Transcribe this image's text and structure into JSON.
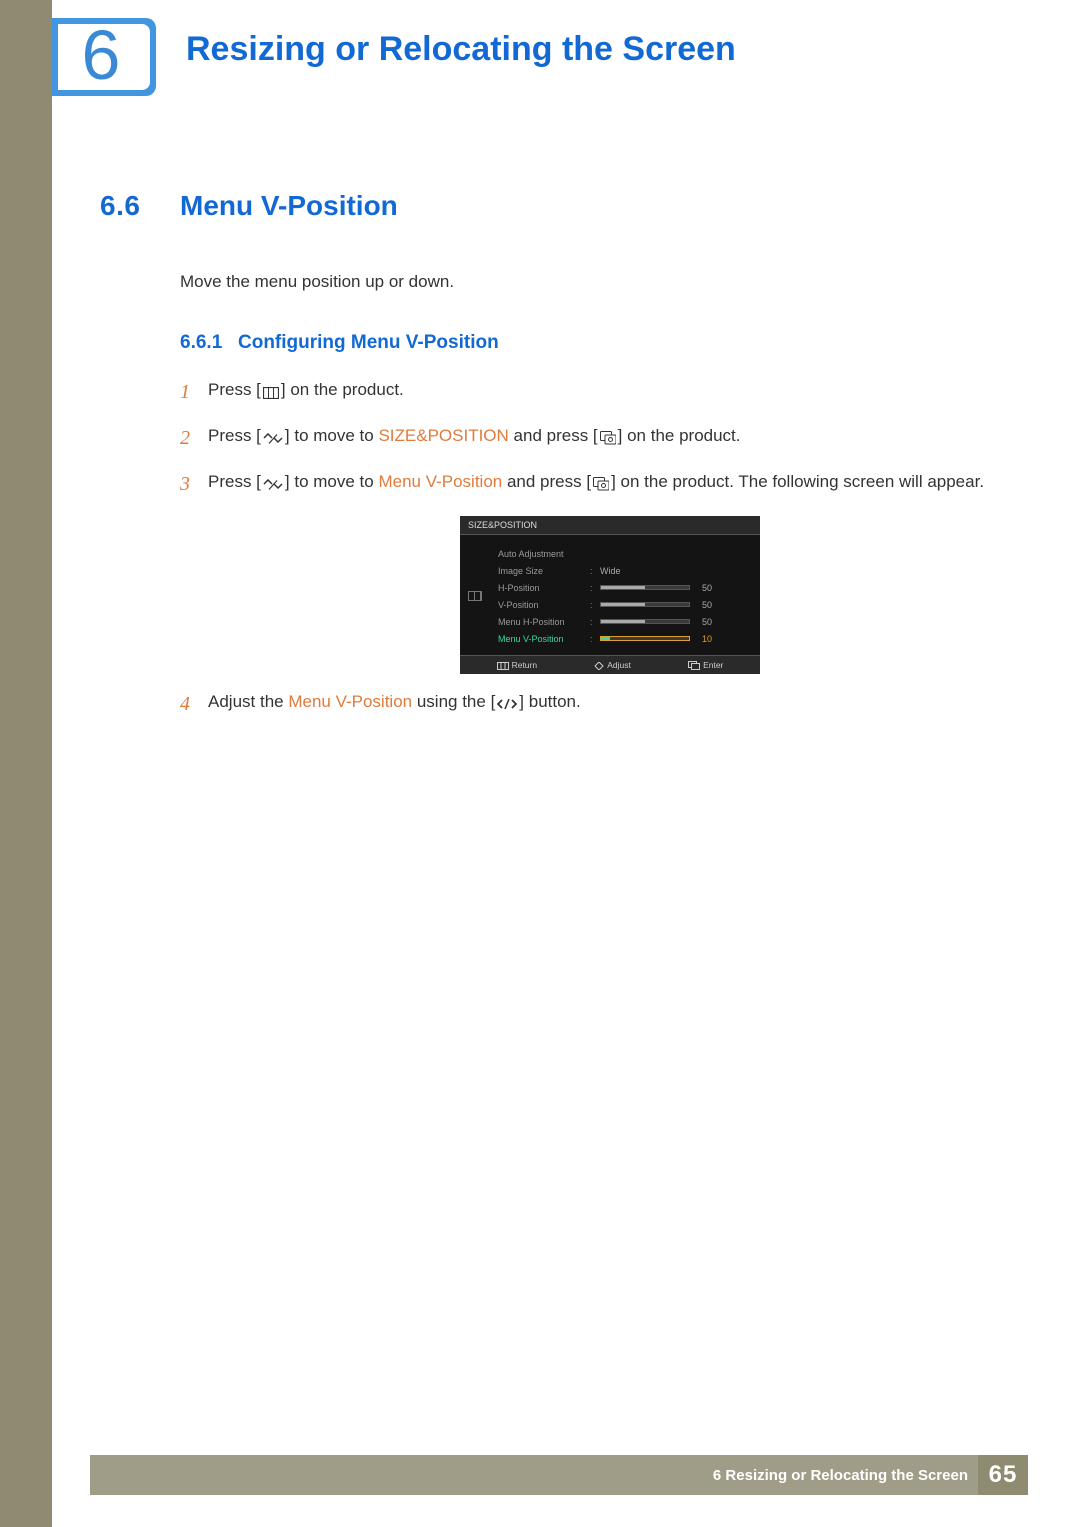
{
  "chapter": {
    "number": "6",
    "title": "Resizing or Relocating the Screen"
  },
  "section": {
    "number": "6.6",
    "title": "Menu V-Position"
  },
  "intro": "Move the menu position up or down.",
  "subsection": {
    "number": "6.6.1",
    "title": "Configuring Menu V-Position"
  },
  "steps": {
    "s1": {
      "num": "1",
      "a": "Press [",
      "b": "] on the product."
    },
    "s2": {
      "num": "2",
      "a": "Press [",
      "b": "] to move to ",
      "hl": "SIZE&POSITION",
      "c": " and press [",
      "d": "] on the product."
    },
    "s3": {
      "num": "3",
      "a": "Press [",
      "b": "] to move to ",
      "hl": "Menu V-Position",
      "c": " and press [",
      "d": "] on the product. The following screen will appear."
    },
    "s4": {
      "num": "4",
      "a": "Adjust the ",
      "hl": "Menu V-Position",
      "b": " using the [",
      "c": "] button."
    }
  },
  "osd": {
    "header": "SIZE&POSITION",
    "rows": [
      {
        "label": "Auto Adjustment",
        "type": "blank"
      },
      {
        "label": "Image Size",
        "type": "text",
        "value": "Wide"
      },
      {
        "label": "H-Position",
        "type": "bar",
        "value": 50,
        "pct": 50
      },
      {
        "label": "V-Position",
        "type": "bar",
        "value": 50,
        "pct": 50
      },
      {
        "label": "Menu H-Position",
        "type": "bar",
        "value": 50,
        "pct": 50
      },
      {
        "label": "Menu V-Position",
        "type": "bar",
        "value": 10,
        "pct": 10,
        "active": true
      }
    ],
    "footer": {
      "return": "Return",
      "adjust": "Adjust",
      "enter": "Enter"
    }
  },
  "footer": {
    "text": "6 Resizing or Relocating the Screen",
    "page": "65"
  }
}
